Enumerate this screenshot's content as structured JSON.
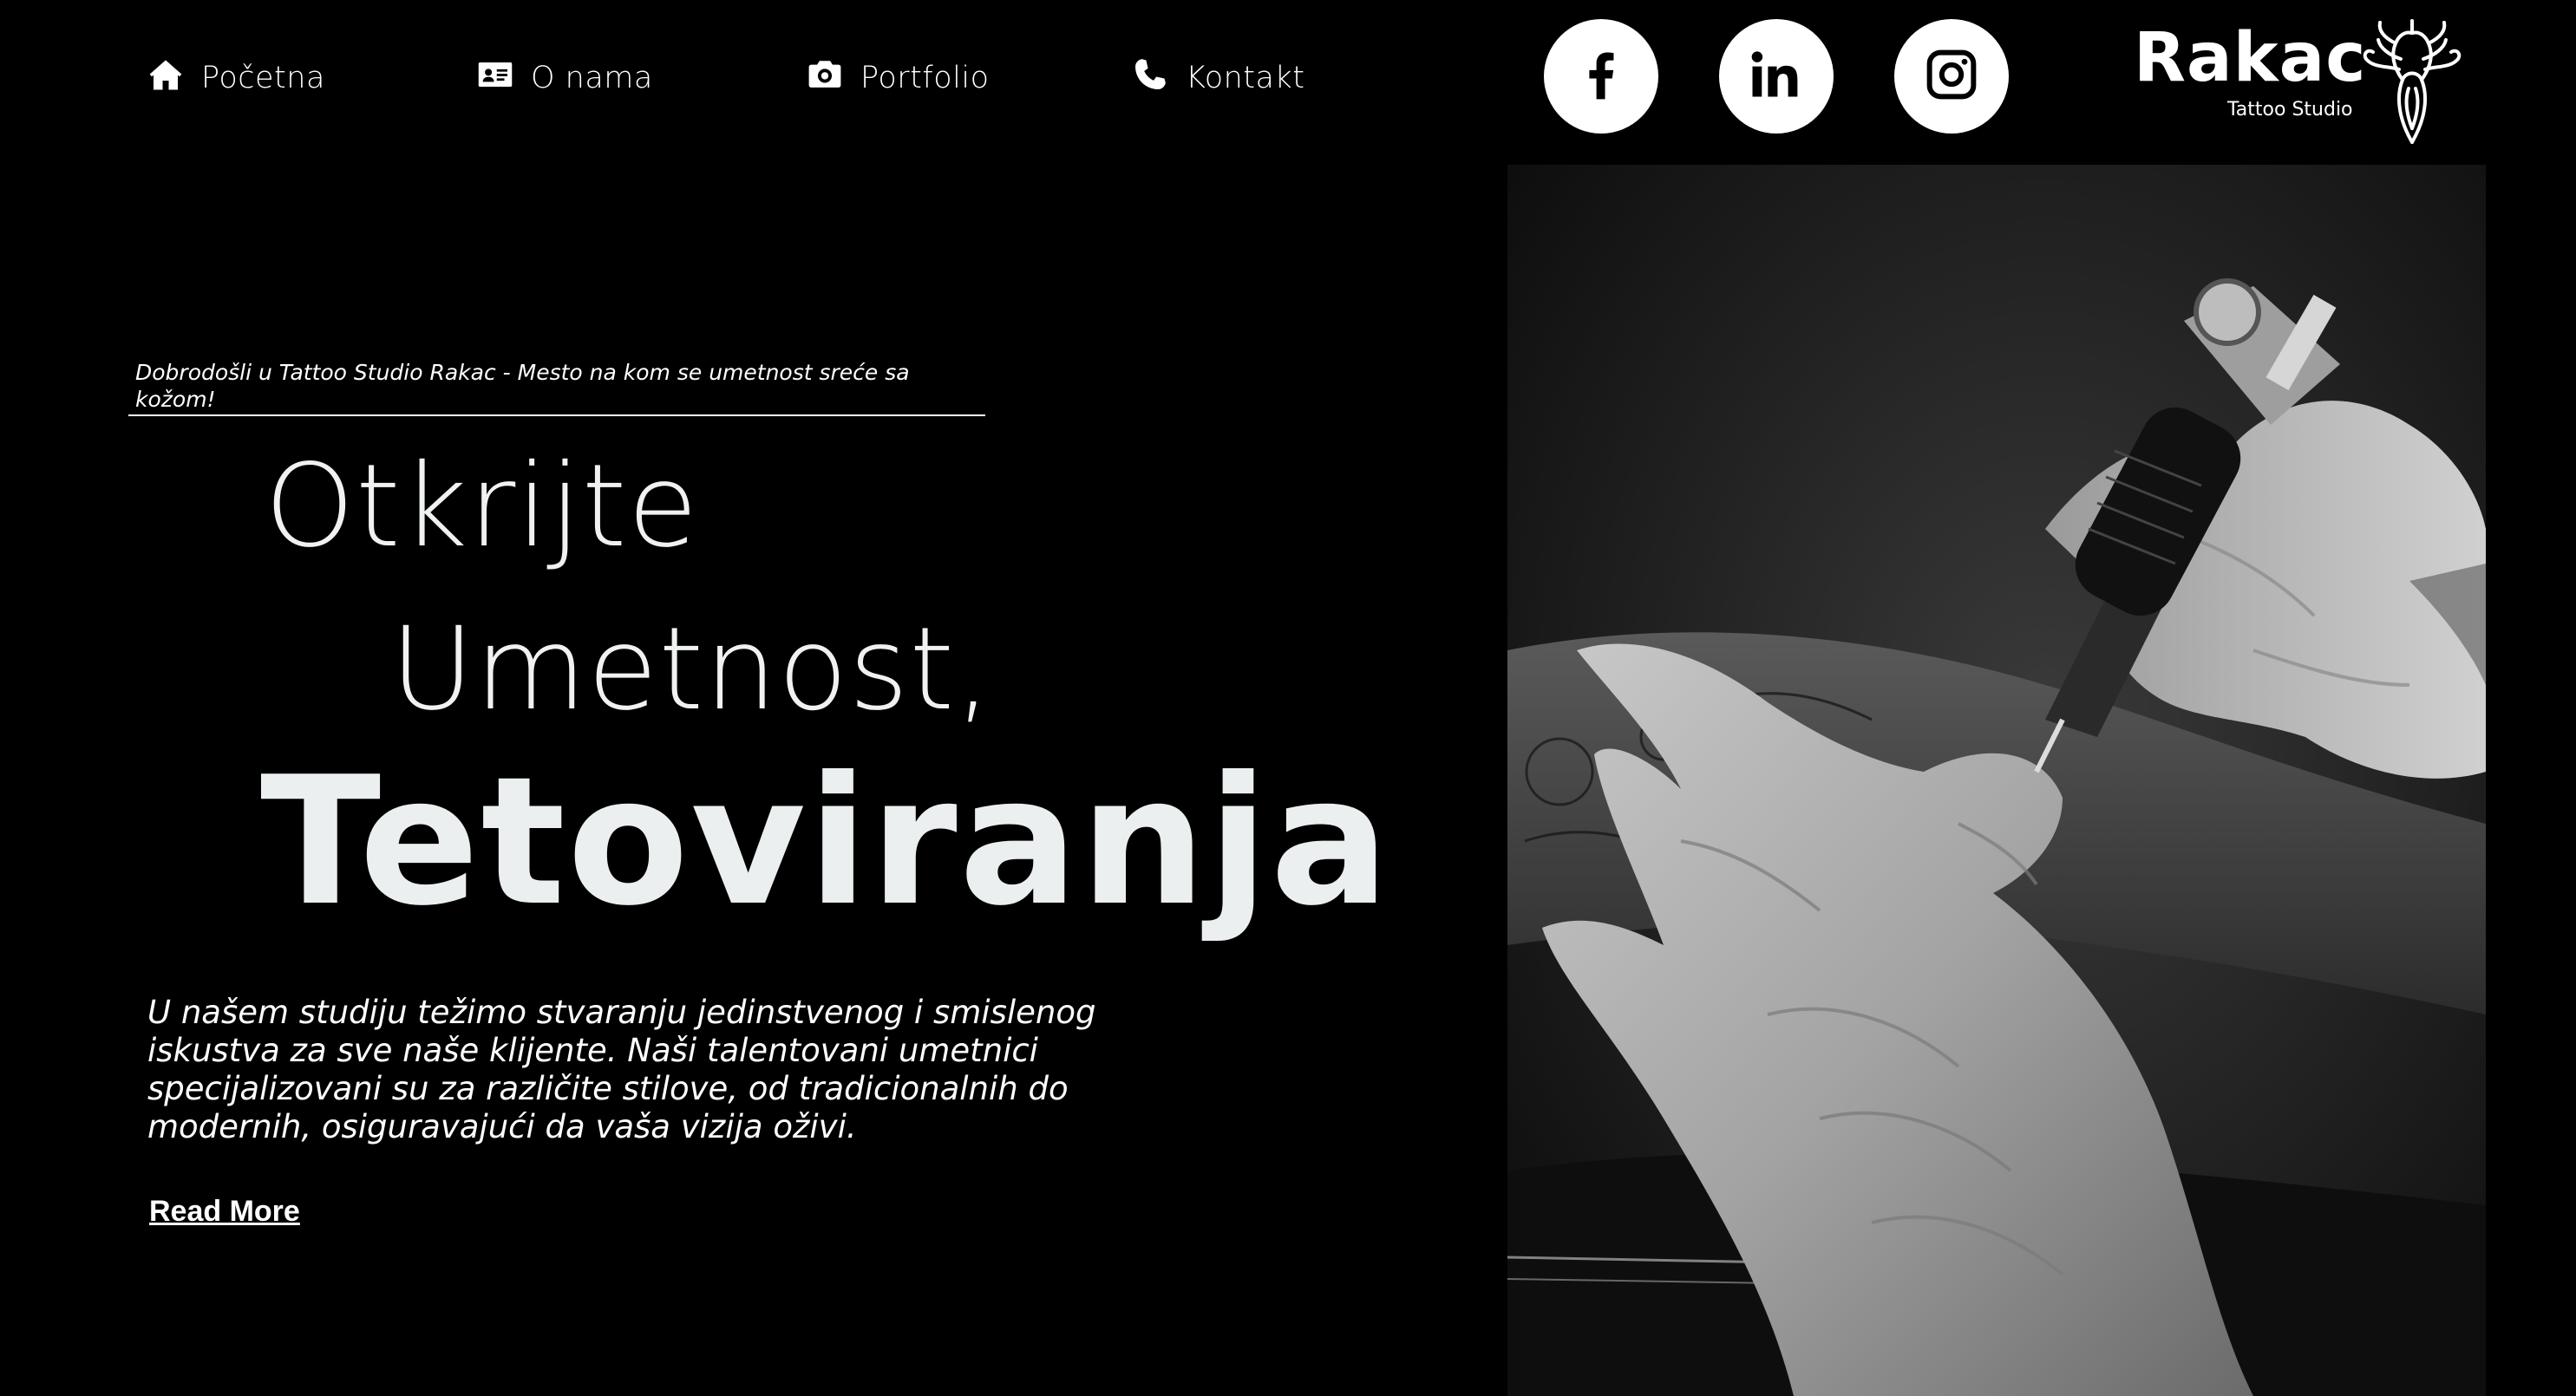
{
  "nav": {
    "items": [
      {
        "label": "Početna",
        "icon": "home-icon"
      },
      {
        "label": "O nama",
        "icon": "id-card-icon"
      },
      {
        "label": "Portfolio",
        "icon": "camera-icon"
      },
      {
        "label": "Kontakt",
        "icon": "phone-icon"
      }
    ]
  },
  "social": {
    "items": [
      {
        "icon": "facebook-icon"
      },
      {
        "icon": "linkedin-icon"
      },
      {
        "icon": "instagram-icon"
      }
    ]
  },
  "logo": {
    "name": "Rakac",
    "subtitle": "Tattoo Studio"
  },
  "hero": {
    "welcome": "Dobrodošli u Tattoo Studio Rakac - Mesto na kom se umetnost sreće sa kožom!",
    "headline_1": "Otkrijte",
    "headline_2": "Umetnost,",
    "headline_3": "Tetoviranja",
    "body": "U našem studiju težimo stvaranju jedinstvenog i smislenog iskustva za sve naše klijente. Naši talentovani umetnici specijalizovani su za različite stilove, od tradicionalnih do modernih, osiguravajući da vaša vizija oživi.",
    "cta": "Read More"
  },
  "theme": {
    "background": "#000000",
    "text": "#ffffff",
    "headline": "#f0f2f2"
  }
}
